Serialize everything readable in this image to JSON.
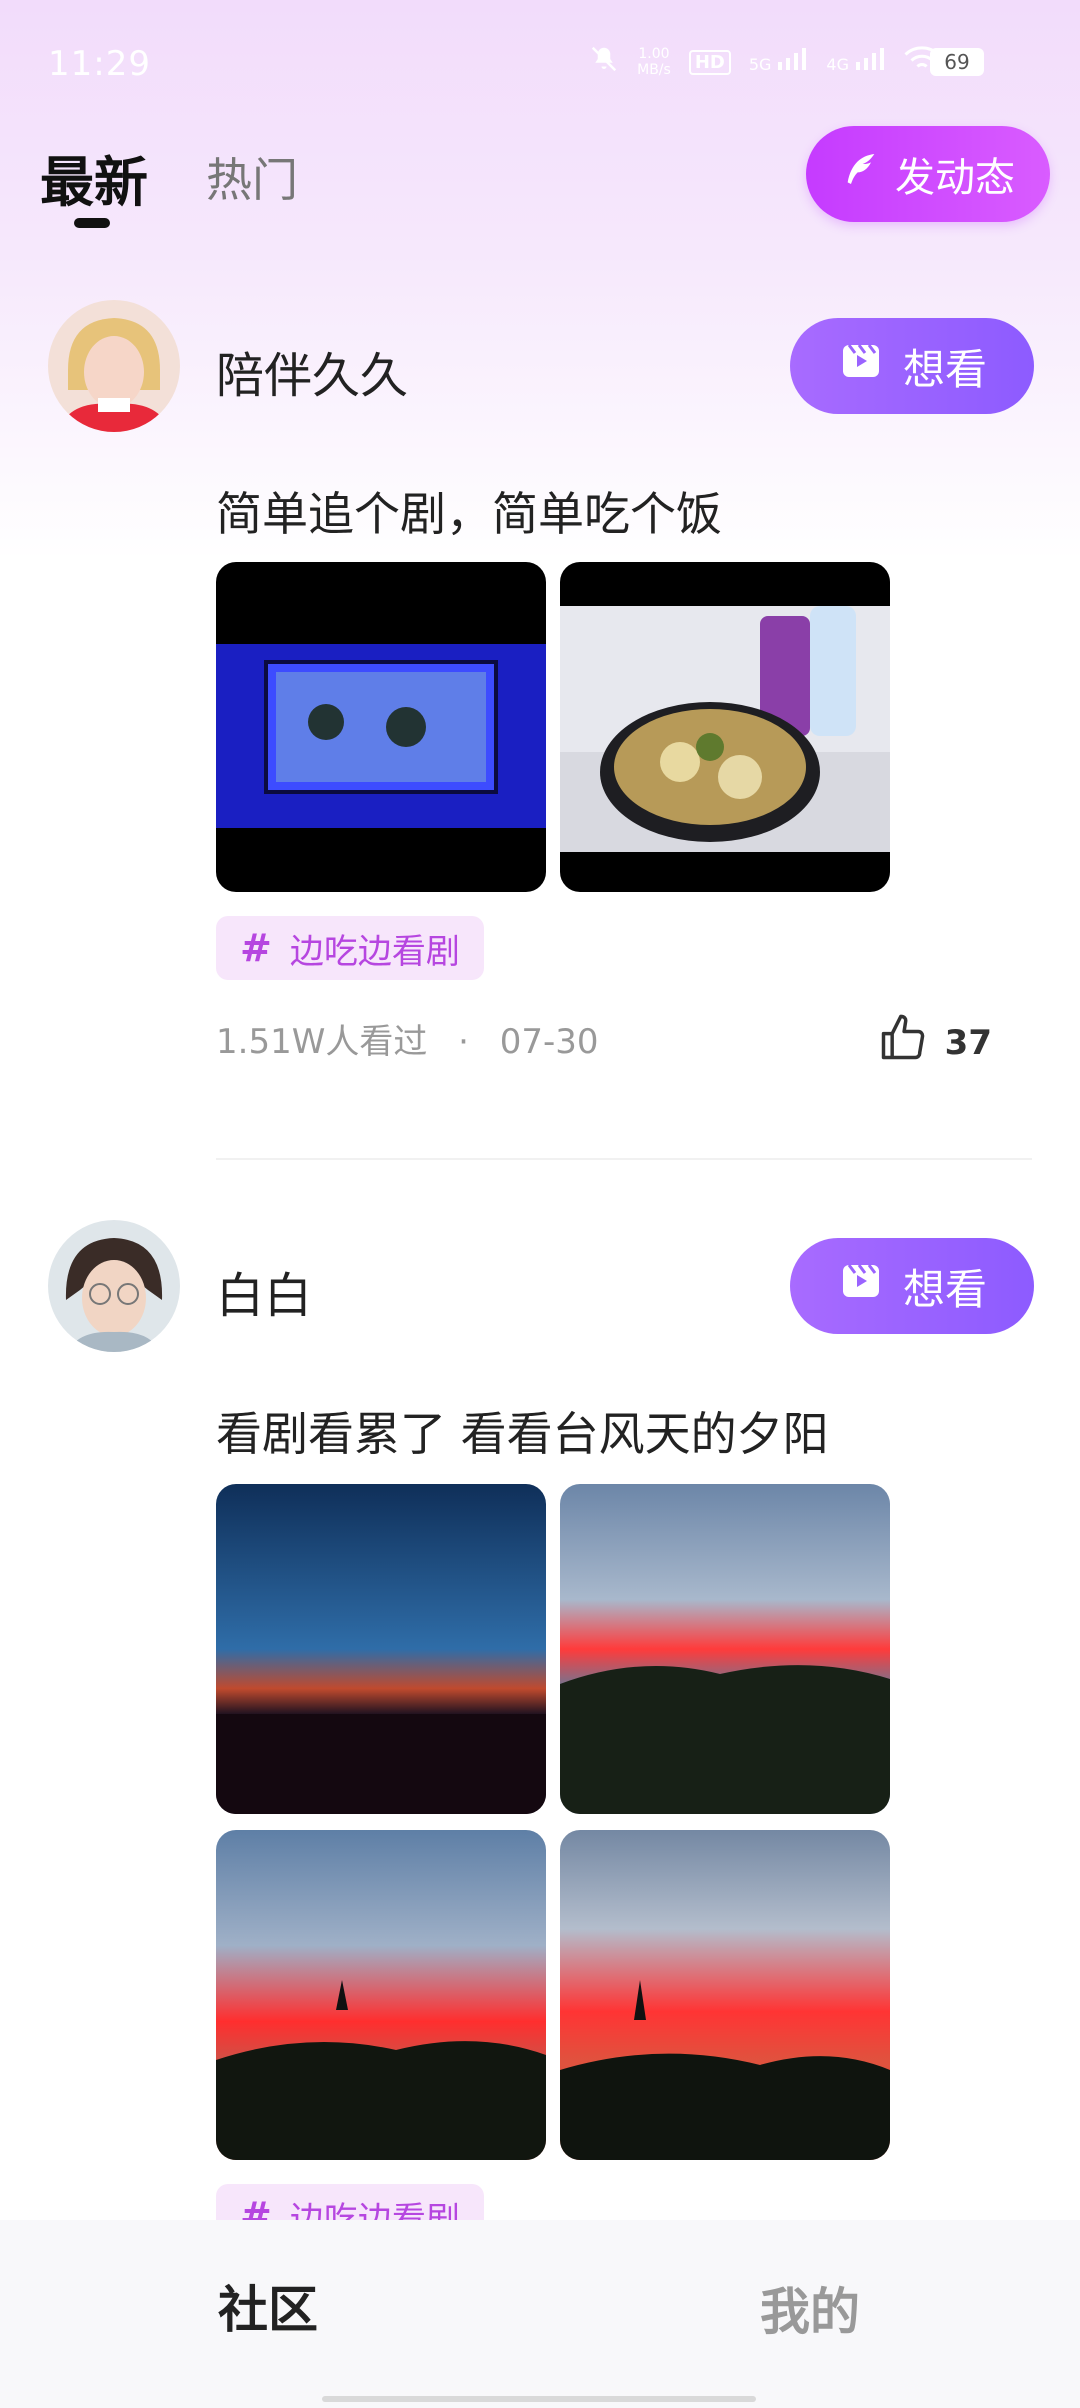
{
  "status_bar": {
    "time": "11:29",
    "net_speed_value": "1.00",
    "net_speed_unit": "MB/s",
    "hd_label": "HD",
    "sim1_label": "5G",
    "sim2_label": "4G",
    "battery": "69",
    "icons": [
      "mute-icon",
      "hd-icon",
      "signal-5g-icon",
      "signal-4g-icon",
      "wifi-icon",
      "battery-icon"
    ]
  },
  "header": {
    "tabs": [
      {
        "label": "最新",
        "active": true
      },
      {
        "label": "热门",
        "active": false
      }
    ],
    "post_button_label": "发动态",
    "post_button_icon": "feather-icon",
    "accent_color": "#c53bff"
  },
  "posts": [
    {
      "username": "陪伴久久",
      "want_button_label": "想看",
      "caption": "简单追个剧，简单吃个饭",
      "images": [
        "tv-screen-photo",
        "food-bowl-photo"
      ],
      "tag": "边吃边看剧",
      "views": "1.51W人看过",
      "separator": "·",
      "date": "07-30",
      "likes": "37"
    },
    {
      "username": "白白",
      "want_button_label": "想看",
      "caption": "看剧看累了 看看台风天的夕阳",
      "images": [
        "sunset-photo-1",
        "sunset-photo-2",
        "sunset-photo-3",
        "sunset-photo-4"
      ],
      "tag": "边吃边看剧"
    }
  ],
  "bottom_nav": {
    "items": [
      {
        "label": "社区",
        "active": true
      },
      {
        "label": "我的",
        "active": false
      }
    ]
  }
}
